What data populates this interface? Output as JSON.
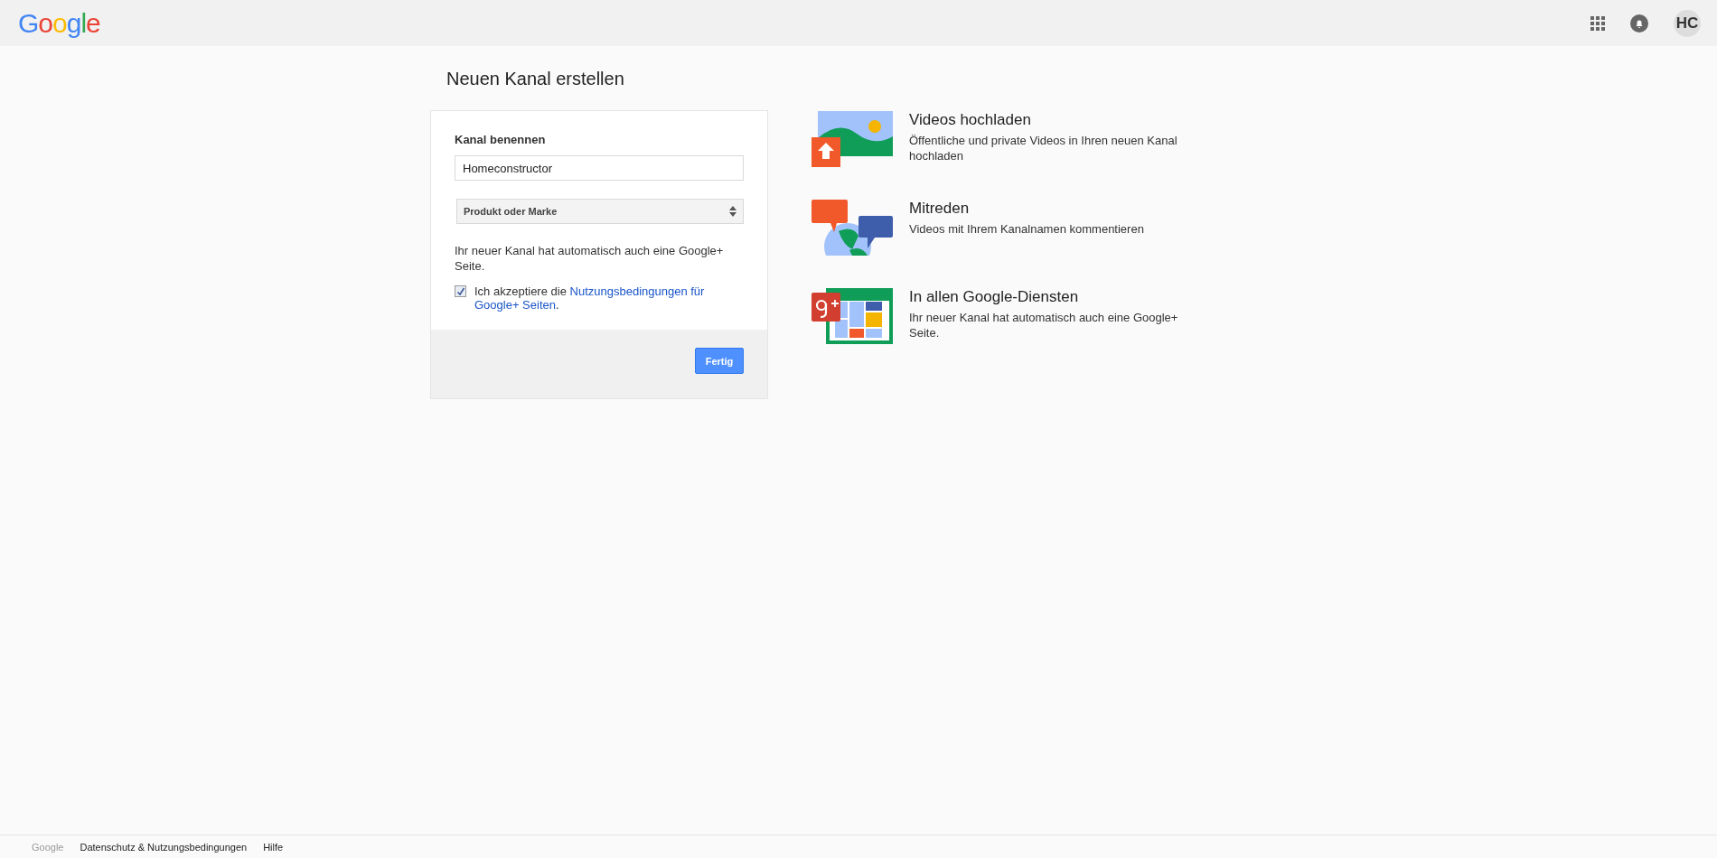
{
  "header": {
    "logo": "Google",
    "avatar": "HC"
  },
  "page_title": "Neuen Kanal erstellen",
  "form": {
    "label": "Kanal benennen",
    "name_value": "Homeconstructor",
    "category": "Produkt oder Marke",
    "info": "Ihr neuer Kanal hat automatisch auch eine Google+ Seite.",
    "terms": {
      "checked": true,
      "text": "Ich akzeptiere die ",
      "link": [
        "Nutzungsbedingungen für",
        "Google+ Seiten"
      ],
      "after": "."
    },
    "submit": "Fertig"
  },
  "features": [
    {
      "kind": "upload",
      "title": "Videos hochladen",
      "text": "Öffentliche und private Videos in Ihren neuen Kanal hochladen"
    },
    {
      "kind": "comment",
      "title": "Mitreden",
      "text": "Videos mit Ihrem Kanalnamen kommentieren"
    },
    {
      "kind": "gplus",
      "title": "In allen Google-Diensten",
      "text": "Ihr neuer Kanal hat automatisch auch eine Google+ Seite."
    }
  ],
  "footer": [
    "Google",
    "Datenschutz & Nutzungsbedingungen",
    "Hilfe"
  ]
}
